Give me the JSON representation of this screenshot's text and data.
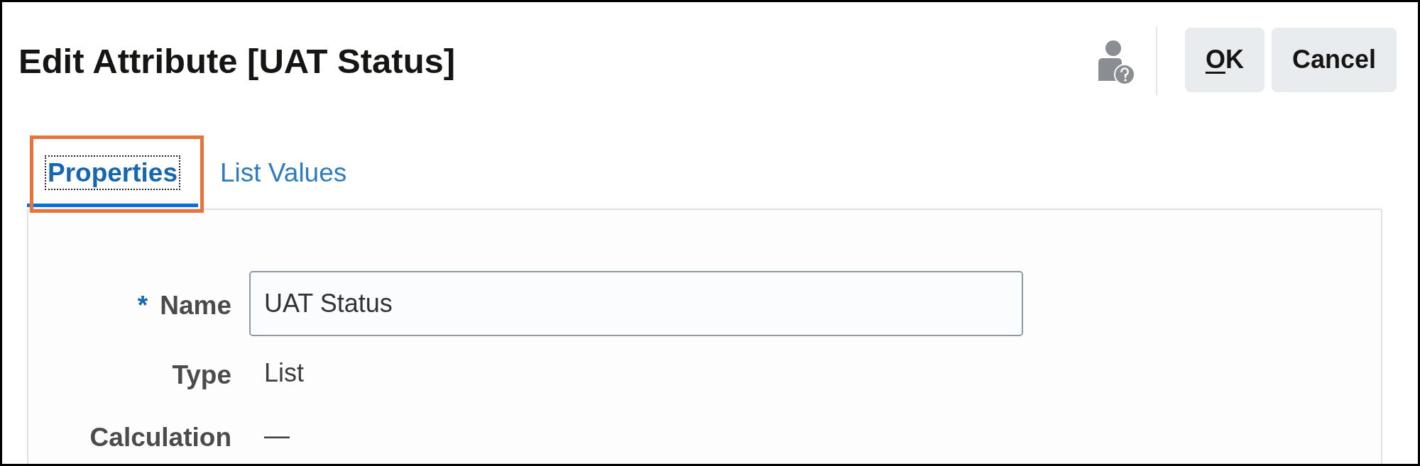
{
  "dialog": {
    "title": "Edit Attribute [UAT Status]"
  },
  "actions": [
    {
      "label": "OK",
      "first_letter_underlined": true
    },
    {
      "label": "Cancel",
      "first_letter_underlined": false
    }
  ],
  "tabs": [
    {
      "label": "Properties",
      "selected": true,
      "focused": true,
      "highlighted": true
    },
    {
      "label": "List Values",
      "selected": false,
      "focused": false,
      "highlighted": false
    }
  ],
  "form": {
    "fields": [
      {
        "kind": "input",
        "label": "Name",
        "required_mark": "*",
        "value": "UAT Status"
      },
      {
        "kind": "text",
        "label": "Type",
        "value": "List"
      },
      {
        "kind": "text",
        "label": "Calculation",
        "value": "—"
      }
    ]
  }
}
